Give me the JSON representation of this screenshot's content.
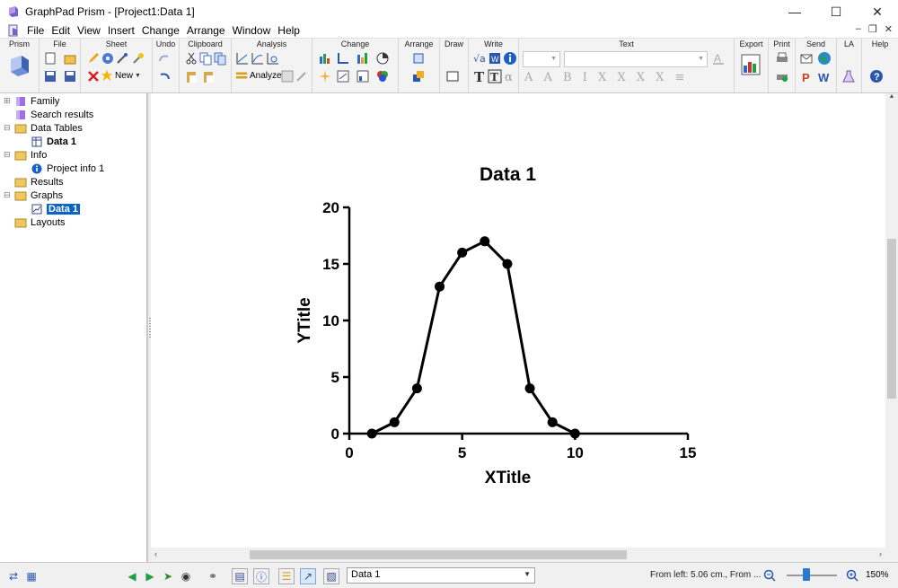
{
  "window": {
    "title": "GraphPad Prism - [Project1:Data 1]"
  },
  "menu": [
    "File",
    "Edit",
    "View",
    "Insert",
    "Change",
    "Arrange",
    "Window",
    "Help"
  ],
  "ribbon": {
    "groups": [
      "Prism",
      "File",
      "Sheet",
      "Undo",
      "Clipboard",
      "Analysis",
      "Change",
      "Arrange",
      "Draw",
      "Write",
      "Text",
      "Export",
      "Print",
      "Send",
      "LA",
      "Help"
    ],
    "sheet_new_label": "New",
    "analyze_label": "Analyze"
  },
  "tree": [
    {
      "label": "Family"
    },
    {
      "label": "Search results"
    },
    {
      "label": "Data Tables"
    },
    {
      "label": "Data 1"
    },
    {
      "label": "Info"
    },
    {
      "label": "Project info 1"
    },
    {
      "label": "Results"
    },
    {
      "label": "Graphs"
    },
    {
      "label": "Data 1"
    },
    {
      "label": "Layouts"
    }
  ],
  "status": {
    "sheet_select": "Data 1",
    "position": "From left: 5.06 cm., From ...",
    "zoom": "150%"
  },
  "chart_data": {
    "type": "line",
    "title": "Data 1",
    "xlabel": "XTitle",
    "ylabel": "YTitle",
    "xlim": [
      0,
      15
    ],
    "ylim": [
      0,
      20
    ],
    "xticks": [
      "0",
      "5",
      "10",
      "15"
    ],
    "yticks": [
      "0",
      "5",
      "10",
      "15",
      "20"
    ],
    "x": [
      1,
      2,
      3,
      4,
      5,
      6,
      7,
      8,
      9,
      10
    ],
    "y": [
      0,
      1,
      4,
      13,
      16,
      17,
      15,
      4,
      1,
      0
    ],
    "grid": false
  }
}
